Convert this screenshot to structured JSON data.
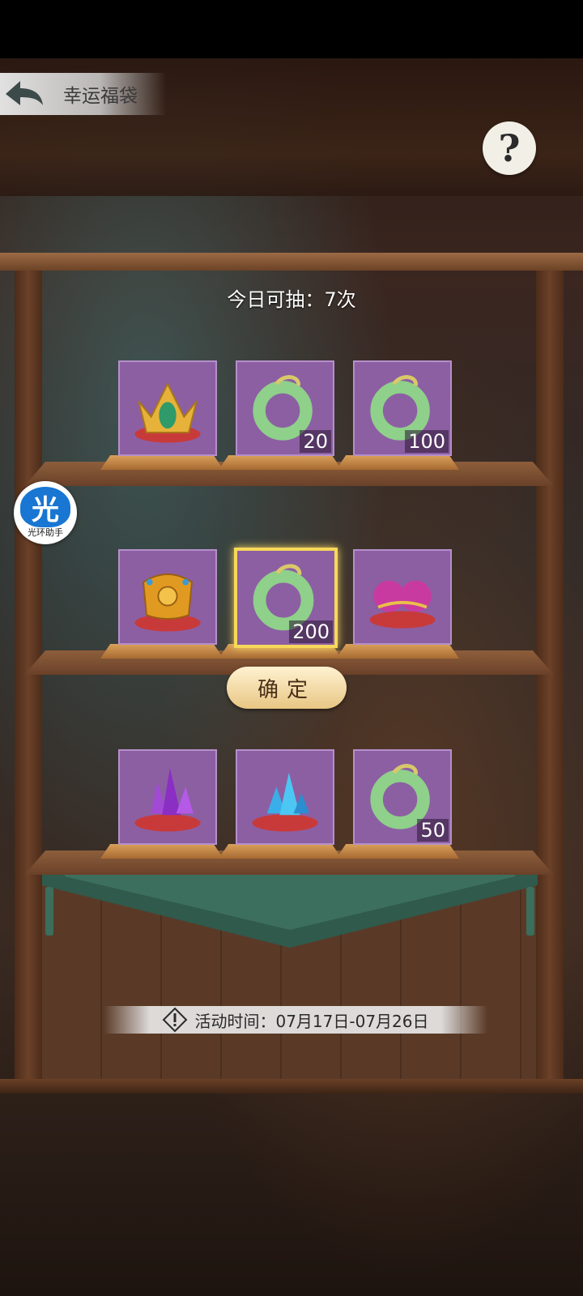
{
  "header": {
    "title": "幸运福袋"
  },
  "draws": {
    "text": "今日可抽：7次"
  },
  "shelves": [
    {
      "items": [
        {
          "name": "gold-jade-crown",
          "qty": ""
        },
        {
          "name": "jade-dragon-ring",
          "qty": "20"
        },
        {
          "name": "jade-dragon-ring",
          "qty": "100"
        }
      ]
    },
    {
      "items": [
        {
          "name": "golden-armor-plate",
          "qty": ""
        },
        {
          "name": "jade-dragon-ring",
          "qty": "200",
          "selected": true
        },
        {
          "name": "pink-pearls",
          "qty": ""
        }
      ]
    },
    {
      "items": [
        {
          "name": "purple-crystal",
          "qty": ""
        },
        {
          "name": "blue-crystal",
          "qty": ""
        },
        {
          "name": "jade-dragon-ring",
          "qty": "50"
        }
      ]
    }
  ],
  "confirm": {
    "label": "确定"
  },
  "helper": {
    "glyph": "光",
    "label": "光环助手"
  },
  "event": {
    "text": "活动时间：07月17日-07月26日"
  },
  "colors": {
    "tile": "#8c5fa3",
    "selected_border": "#f7d85a"
  }
}
